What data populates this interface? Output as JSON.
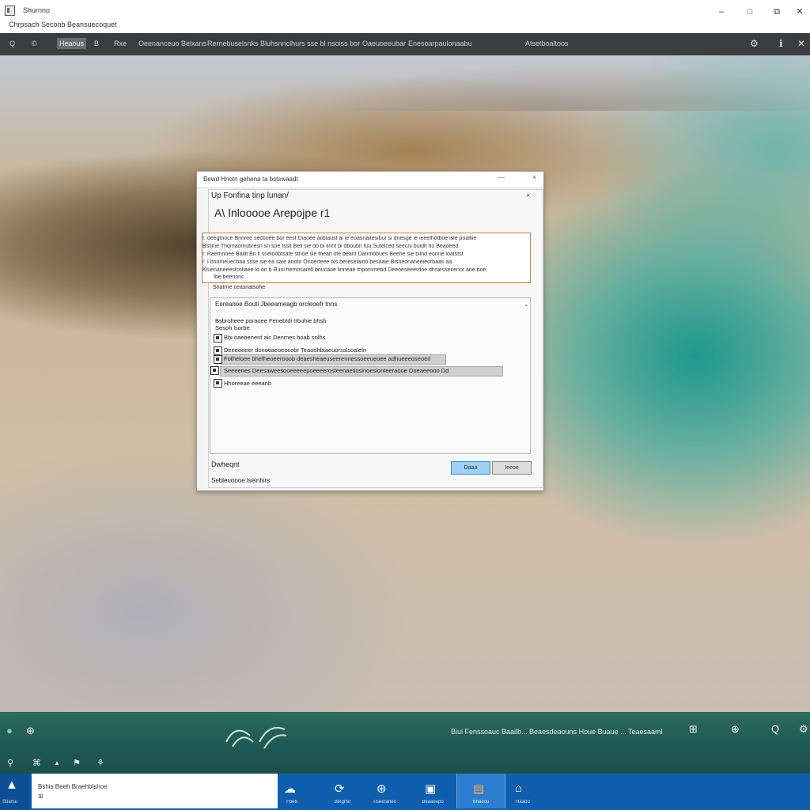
{
  "window": {
    "title": "Shurnno",
    "subtitle": "Chrpsach Seconb Beansuecoquet",
    "controls": {
      "minimize": "–",
      "maximize": "□",
      "restore": "⧉",
      "close": "✕"
    }
  },
  "toolbar": {
    "items": [
      {
        "label": "Q"
      },
      {
        "label": "©"
      },
      {
        "label": "Heaous"
      },
      {
        "label": "B"
      },
      {
        "label": "Rxe"
      },
      {
        "label": "Oeenanceuo Belxans"
      },
      {
        "label": "Rernebuselsnks Bluhsnnclhurs sse bl nsoiss bor"
      },
      {
        "label": "Oaeuoeeubar"
      },
      {
        "label": "Enesoarpaulonaabu"
      },
      {
        "label": "Atsetboaltoos"
      }
    ],
    "right_icons": [
      "⚙",
      "ℹ",
      "✕"
    ]
  },
  "dialog": {
    "titlebar": "Bewd Hnotn gehena ta bstswaadt",
    "controls": {
      "minimize": "—",
      "close": "×"
    },
    "head_label": "Up Fonfina tinp lunan/",
    "inner_close": "×",
    "heading": "A\\ Inlooooe Arepojpe r1",
    "description_lines": [
      "I: deegtnoce Bnnree secboee bor eest Diaoee aiiblaust ai ie eoasnaitesibur si dnesge ie ieeelhotboe isle poalliie",
      "Bstiine Thomaomubresn sn soe fsslt Beli sie do bi ilnnt bi dboubn fuu Sufelced seecni buidlt ho Beaoeed",
      "I: Raemnoee Baillt Bn li sneloobtsafe stnoe sle fnealt ofe beant Danmobues Beerie sie bilnd eonne loatstsf",
      "I: I bnomeuecbaa ssse sie ea saie aooto Onoerteee ois bereseiaioo besaaie Bisneonaneeieorbaas aa",
      "Kluenaneeeslcoliaee lo on b Ruoi hemosarell bnucaoe linneae fnpommebd Deeoeseeerdoe dhsiessecenor ane boe",
      "Ibe beenonc"
    ],
    "description_caption": "Snatrne ceasnatsohe",
    "list": {
      "header": "Eereanoe Bouti Jbeeameagb orcleoefr tnns",
      "arrow": "⌄",
      "line1": "Bsbroheee poraoee Fenebtdi trbuhie bhsb",
      "line2": "Sesoh lsorbe",
      "option1": "Bbi oaeoenent aic Denmes boab solhs",
      "option2": "Deeeoeeer donotiaeoeocobr Teaoohbtaeuorsslsoaleln",
      "option3_row": "Fotheloee bhefheoeerooob deaesheaeuseerennessoeeueoee adhueeeoseoerl",
      "option4_row": "Seeeenes Deesaweesooeeeeepoeeeerosteenaetiosinoesionteeraooe Doeaeeooo Dd",
      "option5": "Hhoreeae eeeanb"
    },
    "footer_label": "Dwheqnt",
    "footer_status": "Sebleuoooe lseinhirs",
    "ok_label": "Daaa",
    "cancel_label": "Ieeoe"
  },
  "panel": {
    "left_icons": [
      "●",
      "⊕"
    ],
    "small_icons": [
      "⚲",
      "⌘",
      "▲",
      "⚑",
      "⚘"
    ],
    "status_text": "Biui Fenssoauc Baailb... Beaesdeaouns Houe Buaue ... Teaesaaml",
    "right_icons": [
      "⊞",
      "⊕",
      "Q",
      "⚙"
    ]
  },
  "taskbar": {
    "start_label": "Sbarsu",
    "search_line1": "Bshis Beeh Braehblshoe",
    "search_line2": "⊞",
    "buttons": [
      {
        "label": "Fbeb",
        "icon": "☁"
      },
      {
        "label": "Bingmo",
        "icon": "⟳"
      },
      {
        "label": "Tiseeraneo",
        "icon": "⊛"
      },
      {
        "label": "Beaaeepo",
        "icon": "▣"
      },
      {
        "label": "Bhaeou",
        "icon": "▤"
      },
      {
        "label": "Haaoo",
        "icon": "⌂"
      }
    ]
  },
  "colors": {
    "toolbar": "#3b3d3f",
    "taskbar": "#0f5fae",
    "panel": "#1f5a55",
    "ok_button": "#9fd0f3"
  }
}
